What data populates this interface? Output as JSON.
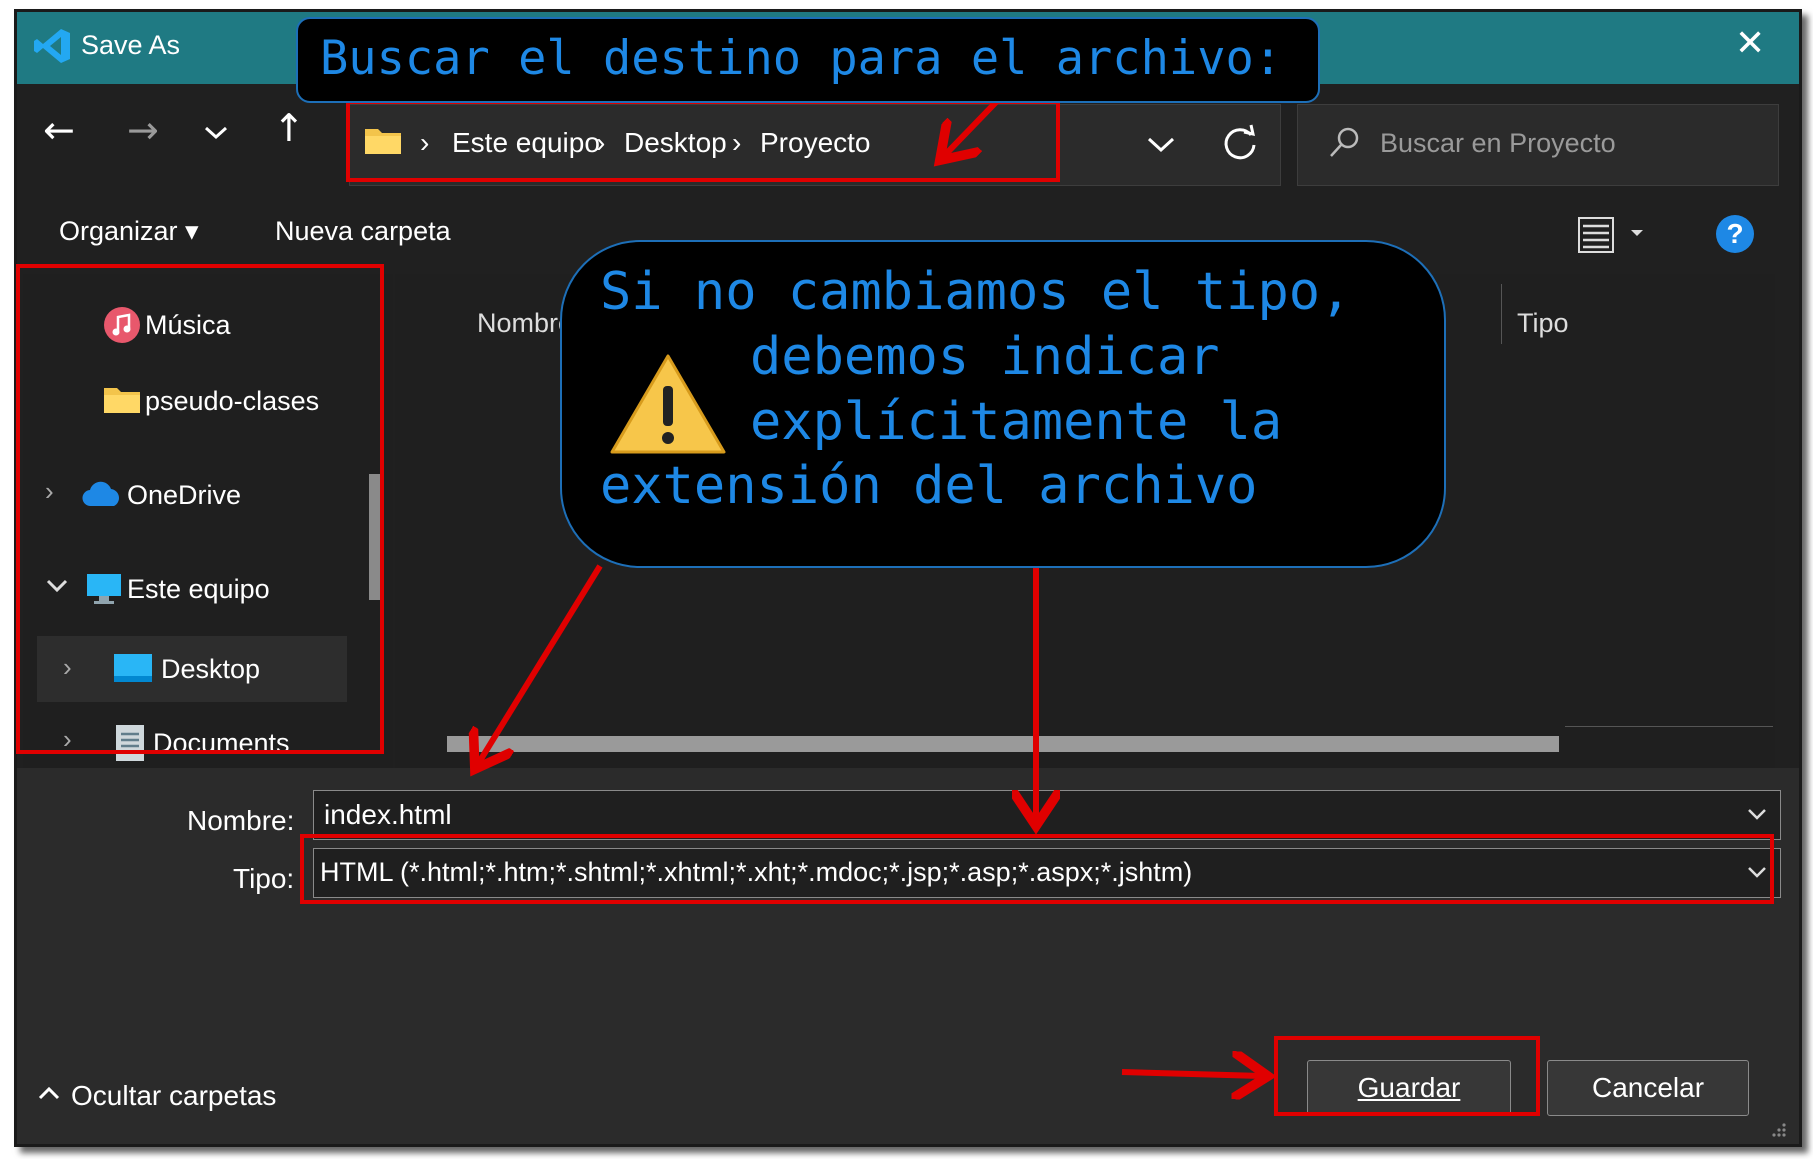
{
  "window": {
    "title": "Save As",
    "close_glyph": "✕"
  },
  "breadcrumb": {
    "items": [
      "Este equipo",
      "Desktop",
      "Proyecto"
    ],
    "separator": "›"
  },
  "search": {
    "placeholder": "Buscar en Proyecto"
  },
  "toolbar": {
    "organize_label": "Organizar",
    "new_folder_label": "Nueva carpeta",
    "help_glyph": "?"
  },
  "columns": {
    "name": "Nombre",
    "type": "Tipo"
  },
  "sidebar": {
    "items": [
      {
        "label": "Música",
        "icon": "music-icon"
      },
      {
        "label": "pseudo-clases",
        "icon": "folder-icon"
      },
      {
        "label": "OneDrive",
        "icon": "cloud-icon"
      },
      {
        "label": "Este equipo",
        "icon": "computer-icon"
      },
      {
        "label": "Desktop",
        "icon": "desktop-icon"
      },
      {
        "label": "Documents",
        "icon": "document-icon"
      }
    ]
  },
  "form": {
    "name_label": "Nombre:",
    "name_value": "index.html",
    "type_label": "Tipo:",
    "type_value": "HTML (*.html;*.htm;*.shtml;*.xhtml;*.xht;*.mdoc;*.jsp;*.asp;*.aspx;*.jshtm)"
  },
  "footer": {
    "hide_folders_label": "Ocultar carpetas",
    "save_label": "Guardar",
    "cancel_label": "Cancelar"
  },
  "annotations": {
    "top": "Buscar el destino para el archivo:",
    "warning_lines": [
      "Si no cambiamos el tipo,",
      "debemos indicar",
      "explícitamente la",
      "extensión del archivo"
    ],
    "warning_icon": "warning-icon"
  },
  "colors": {
    "titlebar": "#1f7a83",
    "accent_text": "#1e88e5",
    "highlight": "#e00000"
  }
}
